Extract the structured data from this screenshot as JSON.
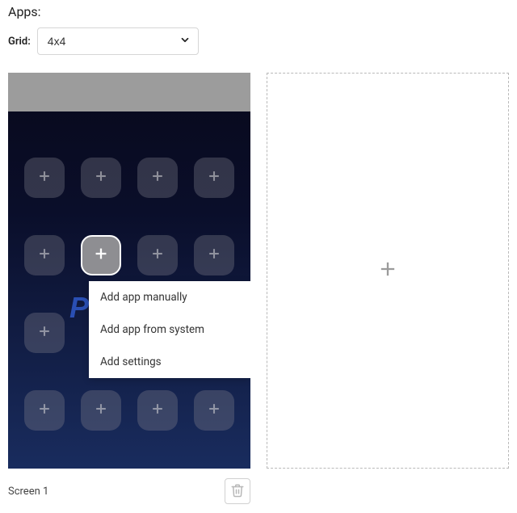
{
  "apps_label": "Apps:",
  "grid_label": "Grid:",
  "grid_select": {
    "value": "4x4",
    "options": [
      "4x4"
    ]
  },
  "screens": [
    {
      "label": "Screen 1",
      "background_logo_fragment": "P",
      "slots": {
        "rows": 4,
        "cols": 4,
        "active_row": 1,
        "active_col": 1
      }
    }
  ],
  "context_menu": {
    "items": [
      "Add app manually",
      "Add app from system",
      "Add settings"
    ]
  },
  "icons": {
    "plus": "plus-icon",
    "chevron_down": "chevron-down-icon",
    "trash": "trash-icon"
  },
  "colors": {
    "phone_gradient_top": "#08091b",
    "phone_gradient_bottom": "#192c5e",
    "status_bar": "#9c9c9c",
    "slot_bg": "rgba(130,130,140,0.35)",
    "slot_active_bg": "#8e8e92",
    "logo_color": "#2a4fb3",
    "add_screen_border": "#b9b9b9"
  }
}
